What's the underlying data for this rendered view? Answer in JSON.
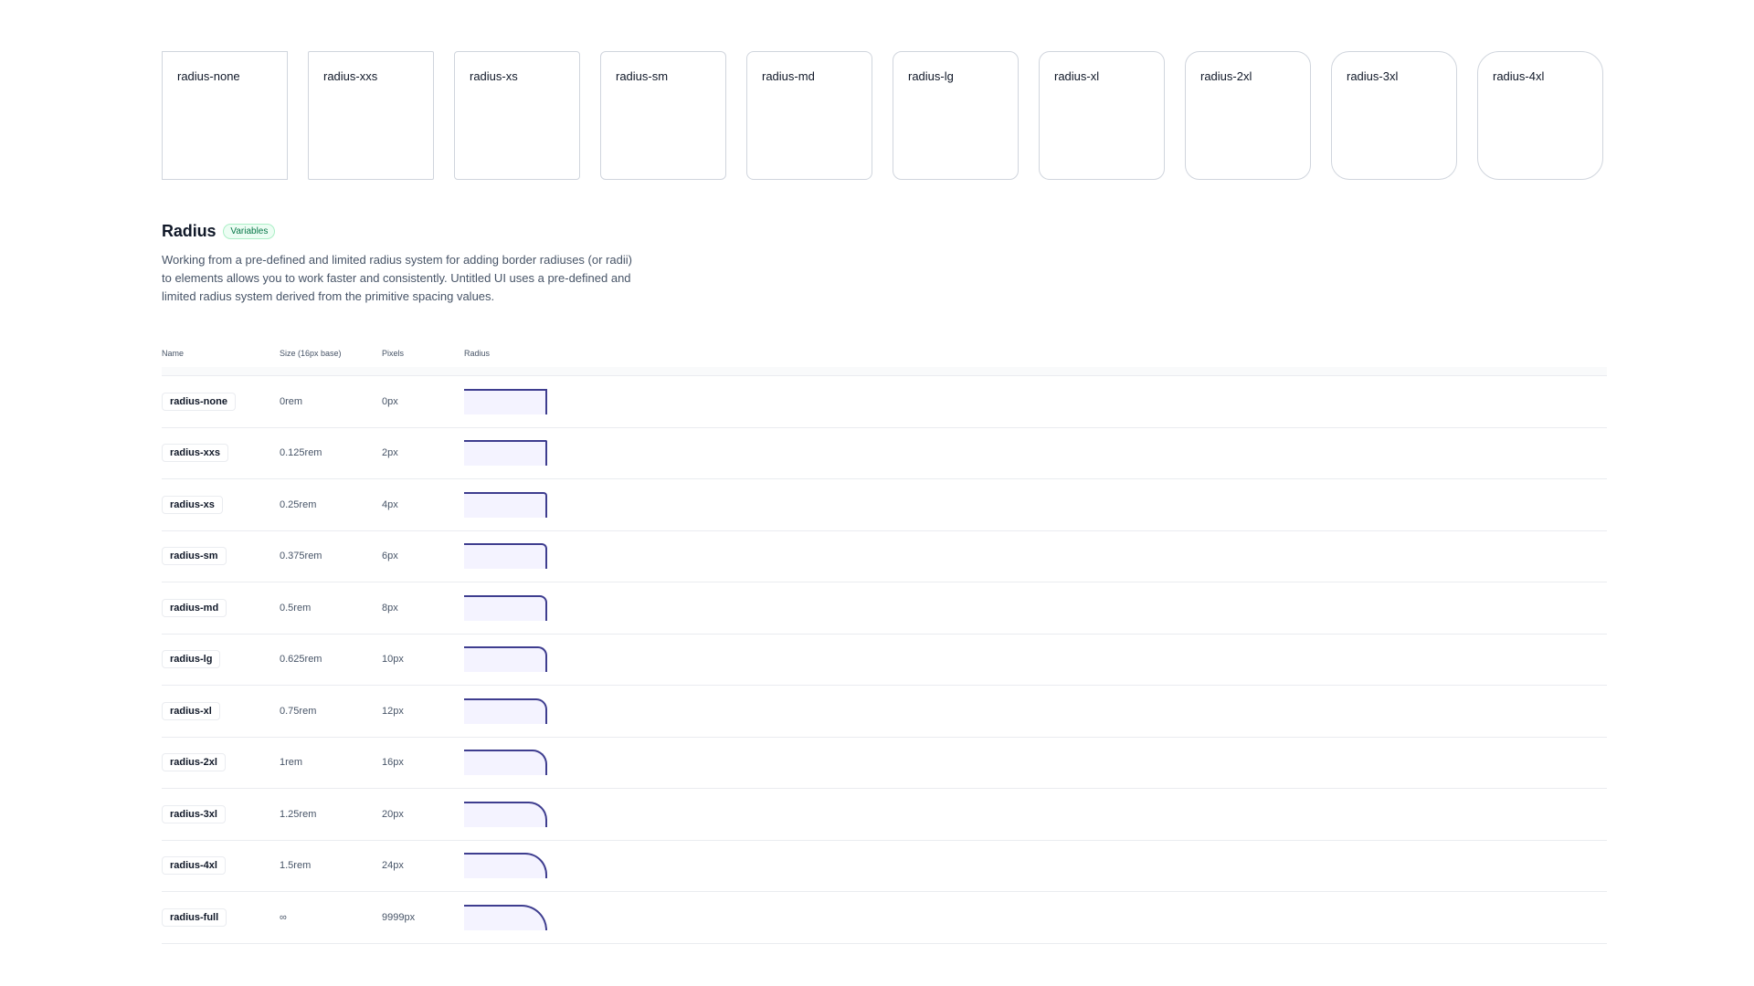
{
  "cards": [
    {
      "label": "radius-none",
      "radius": 0
    },
    {
      "label": "radius-xxs",
      "radius": 2
    },
    {
      "label": "radius-xs",
      "radius": 4
    },
    {
      "label": "radius-sm",
      "radius": 6
    },
    {
      "label": "radius-md",
      "radius": 8
    },
    {
      "label": "radius-lg",
      "radius": 10
    },
    {
      "label": "radius-xl",
      "radius": 12
    },
    {
      "label": "radius-2xl",
      "radius": 16
    },
    {
      "label": "radius-3xl",
      "radius": 20
    },
    {
      "label": "radius-4xl",
      "radius": 24
    }
  ],
  "section": {
    "title": "Radius",
    "badge": "Variables",
    "description": "Working from a pre-defined and limited radius system for adding border radiuses (or radii) to elements allows you to work faster and consistently. Untitled UI uses a pre-defined and limited radius system derived from the primitive spacing values."
  },
  "table": {
    "headers": {
      "name": "Name",
      "size": "Size (16px base)",
      "pixels": "Pixels",
      "radius": "Radius"
    },
    "rows": [
      {
        "name": "radius-none",
        "size": "0rem",
        "pixels": "0px",
        "radius": 0
      },
      {
        "name": "radius-xxs",
        "size": "0.125rem",
        "pixels": "2px",
        "radius": 2
      },
      {
        "name": "radius-xs",
        "size": "0.25rem",
        "pixels": "4px",
        "radius": 4
      },
      {
        "name": "radius-sm",
        "size": "0.375rem",
        "pixels": "6px",
        "radius": 6
      },
      {
        "name": "radius-md",
        "size": "0.5rem",
        "pixels": "8px",
        "radius": 8
      },
      {
        "name": "radius-lg",
        "size": "0.625rem",
        "pixels": "10px",
        "radius": 10
      },
      {
        "name": "radius-xl",
        "size": "0.75rem",
        "pixels": "12px",
        "radius": 12
      },
      {
        "name": "radius-2xl",
        "size": "1rem",
        "pixels": "16px",
        "radius": 16
      },
      {
        "name": "radius-3xl",
        "size": "1.25rem",
        "pixels": "20px",
        "radius": 20
      },
      {
        "name": "radius-4xl",
        "size": "1.5rem",
        "pixels": "24px",
        "radius": 24
      },
      {
        "name": "radius-full",
        "size": "∞",
        "pixels": "9999px",
        "radius": 9999
      }
    ]
  },
  "colors": {
    "accent_stroke": "#3e3d8f",
    "accent_fill": "#f4f3ff",
    "badge_text": "#067647",
    "badge_bg": "#ecfdf3"
  }
}
